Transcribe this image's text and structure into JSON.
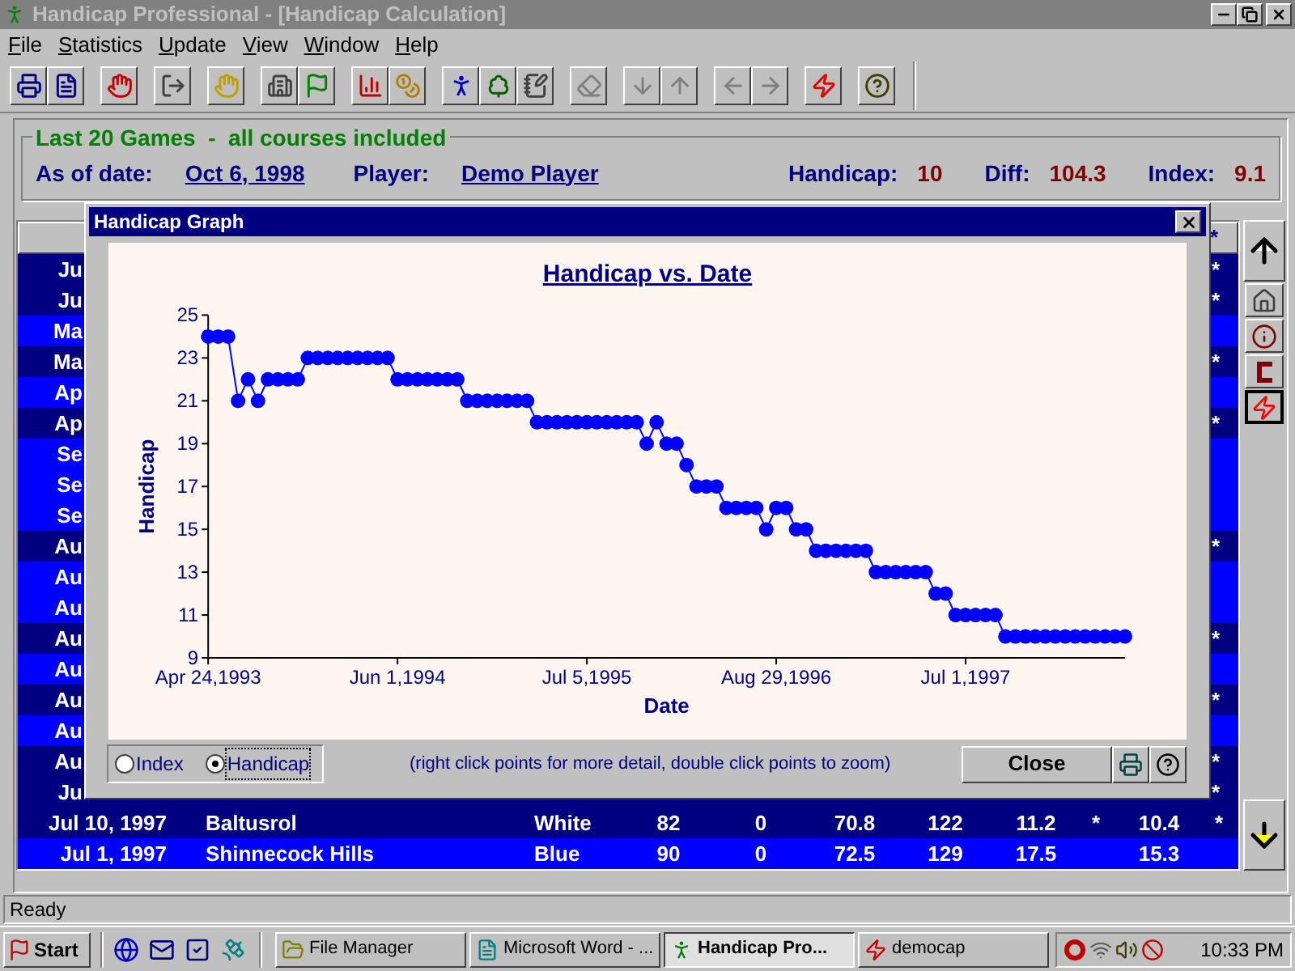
{
  "window": {
    "title": "Handicap Professional - [Handicap Calculation]"
  },
  "menu": [
    "File",
    "Statistics",
    "Update",
    "View",
    "Window",
    "Help"
  ],
  "toolbar": [
    [
      {
        "disabled": false
      },
      {
        "disabled": false
      }
    ],
    [
      {
        "disabled": false
      }
    ],
    [
      {
        "disabled": false
      }
    ],
    [
      {
        "disabled": false
      }
    ],
    [
      {
        "disabled": false
      },
      {
        "disabled": false
      }
    ],
    [
      {
        "disabled": false
      },
      {
        "disabled": false
      }
    ],
    [
      {
        "disabled": false
      },
      {
        "disabled": false
      },
      {
        "disabled": false
      }
    ],
    [
      {
        "disabled": true
      }
    ],
    [
      {
        "disabled": true
      },
      {
        "disabled": true
      }
    ],
    [
      {
        "disabled": true
      },
      {
        "disabled": true
      }
    ],
    [
      {
        "disabled": false
      }
    ],
    [
      {
        "disabled": false
      }
    ]
  ],
  "summary": {
    "legend": "Last 20 Games  -  all courses included",
    "fields": [
      {
        "label": "As of date:",
        "value": "Oct 6, 1998",
        "kind": "link"
      },
      {
        "label": "Player:",
        "value": "Demo Player",
        "kind": "link"
      },
      {
        "label": "Handicap:",
        "value": "10",
        "kind": "stat"
      },
      {
        "label": "Diff:",
        "value": "104.3",
        "kind": "stat"
      },
      {
        "label": "Index:",
        "value": "9.1",
        "kind": "stat"
      }
    ]
  },
  "table": {
    "header_flag": "*",
    "rows": [
      {
        "kind": "partial",
        "date": "Ju",
        "counted": true,
        "flag": "*"
      },
      {
        "kind": "partial",
        "date": "Ju",
        "counted": true,
        "flag": "*"
      },
      {
        "kind": "partial",
        "date": "Ma",
        "counted": false
      },
      {
        "kind": "partial",
        "date": "Ma",
        "counted": true,
        "flag": "*"
      },
      {
        "kind": "partial",
        "date": "Ap",
        "counted": false
      },
      {
        "kind": "partial",
        "date": "Ap",
        "counted": true,
        "flag": "*"
      },
      {
        "kind": "partial",
        "date": "Se",
        "counted": false
      },
      {
        "kind": "partial",
        "date": "Se",
        "counted": false
      },
      {
        "kind": "partial",
        "date": "Se",
        "counted": false
      },
      {
        "kind": "partial",
        "date": "Au",
        "counted": true,
        "flag": "*"
      },
      {
        "kind": "partial",
        "date": "Au",
        "counted": false
      },
      {
        "kind": "partial",
        "date": "Au",
        "counted": false
      },
      {
        "kind": "partial",
        "date": "Au",
        "counted": true,
        "flag": "*"
      },
      {
        "kind": "partial",
        "date": "Au",
        "counted": false
      },
      {
        "kind": "partial",
        "date": "Au",
        "counted": true,
        "flag": "*"
      },
      {
        "kind": "partial",
        "date": "Au",
        "counted": false
      },
      {
        "kind": "partial",
        "date": "Au",
        "counted": true,
        "flag": "*"
      },
      {
        "kind": "partial",
        "date": "Ju",
        "counted": true,
        "flag": "*"
      },
      {
        "kind": "full",
        "date": "Jul 10, 1997",
        "course": "Baltusrol",
        "tee": "White",
        "score": "82",
        "column_5": "0",
        "rating": "70.8",
        "slope": "122",
        "diff": "11.2",
        "diff_mark": "*",
        "index": "10.4",
        "counted": true,
        "flag": "*"
      },
      {
        "kind": "full",
        "date": "Jul 1, 1997",
        "course": "Shinnecock Hills",
        "tee": "Blue",
        "score": "90",
        "column_5": "0",
        "rating": "72.5",
        "slope": "129",
        "diff": "17.5",
        "index": "15.3",
        "counted": false
      }
    ]
  },
  "side_buttons": [
    {
      "pressed": false
    },
    {
      "pressed": false
    },
    {
      "pressed": false
    },
    {
      "pressed": false
    },
    {
      "pressed": true
    },
    {
      "pressed": false
    }
  ],
  "graph": {
    "title": "Handicap Graph",
    "chart_data": {
      "type": "line",
      "title": "Handicap vs. Date",
      "xlabel": "Date",
      "ylabel": "Handicap",
      "categories": [
        "Apr 24,1993",
        null,
        null,
        null,
        null,
        null,
        null,
        null,
        null,
        null,
        null,
        null,
        null,
        null,
        null,
        null,
        null,
        null,
        null,
        "Jun 1,1994",
        null,
        null,
        null,
        null,
        null,
        null,
        null,
        null,
        null,
        null,
        null,
        null,
        null,
        null,
        null,
        null,
        null,
        null,
        "Jul 5,1995",
        null,
        null,
        null,
        null,
        null,
        null,
        null,
        null,
        null,
        null,
        null,
        null,
        null,
        null,
        null,
        null,
        null,
        null,
        "Aug 29,1996",
        null,
        null,
        null,
        null,
        null,
        null,
        null,
        null,
        null,
        null,
        null,
        null,
        null,
        null,
        null,
        null,
        null,
        null,
        "Jul 1,1997",
        null,
        null,
        null,
        null,
        null,
        null,
        null,
        null,
        null,
        null,
        null,
        null,
        null,
        null,
        null,
        null
      ],
      "series": [
        {
          "color": "#0000ff",
          "marker": "circle",
          "values": [
            24,
            24,
            24,
            21,
            22,
            21,
            22,
            22,
            22,
            22,
            23,
            23,
            23,
            23,
            23,
            23,
            23,
            23,
            23,
            22,
            22,
            22,
            22,
            22,
            22,
            22,
            21,
            21,
            21,
            21,
            21,
            21,
            21,
            20,
            20,
            20,
            20,
            20,
            20,
            20,
            20,
            20,
            20,
            20,
            19,
            20,
            19,
            19,
            18,
            17,
            17,
            17,
            16,
            16,
            16,
            16,
            15,
            16,
            16,
            15,
            15,
            14,
            14,
            14,
            14,
            14,
            14,
            13,
            13,
            13,
            13,
            13,
            13,
            12,
            12,
            11,
            11,
            11,
            11,
            11,
            10,
            10,
            10,
            10,
            10,
            10,
            10,
            10,
            10,
            10,
            10,
            10,
            10
          ]
        }
      ],
      "ylim": [
        9,
        25
      ],
      "yticks": [
        9,
        11,
        13,
        15,
        17,
        19,
        21,
        23,
        25
      ]
    },
    "options": [
      {
        "label": "Index",
        "selected": false
      },
      {
        "label": "Handicap",
        "selected": true
      }
    ],
    "hint": "(right click points for more detail, double click points to zoom)",
    "close": "Close"
  },
  "status": "Ready",
  "taskbar": {
    "start": "Start",
    "tasks": [
      {
        "label": "File Manager",
        "selected": false
      },
      {
        "label": "Microsoft Word - ...",
        "selected": false
      },
      {
        "label": "Handicap Pro...",
        "selected": true
      },
      {
        "label": "democap",
        "selected": false
      }
    ],
    "clock": "10:33 PM"
  }
}
